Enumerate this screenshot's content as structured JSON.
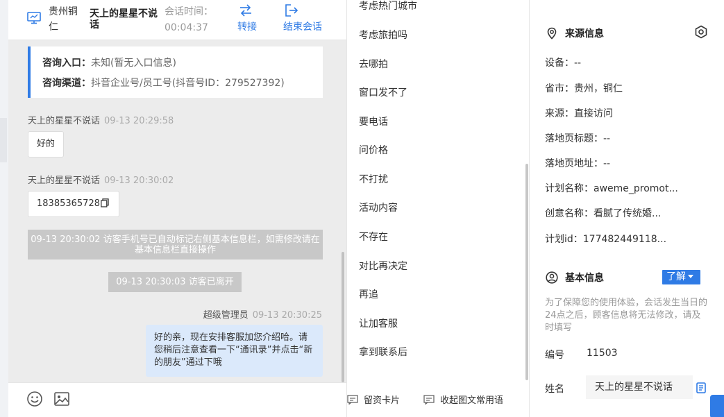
{
  "header": {
    "location": "贵州铜仁",
    "visitor_name": "天上的星星不说话",
    "session_time_label": "会话时间：",
    "session_time_value": "00:04:37",
    "transfer_label": "转接",
    "end_label": "结束会话",
    "accent_color": "#2f7be5"
  },
  "info_card": {
    "entry_key": "咨询入口：",
    "entry_value": "未知(暂无入口信息)",
    "channel_key": "咨询渠道：",
    "channel_value": "抖音企业号/员工号(抖音号ID：279527392)"
  },
  "messages": [
    {
      "sender": "天上的星星不说话",
      "time": "09-13 20:29:58",
      "text": "好的"
    },
    {
      "sender": "天上的星星不说话",
      "time": "09-13 20:30:02",
      "text": "18385365728"
    }
  ],
  "system_notices": [
    "09-13 20:30:02 访客手机号已自动标记右侧基本信息栏，如需修改请在基本信息栏直接操作",
    "09-13 20:30:03 访客已离开"
  ],
  "agent_message": {
    "sender": "超级管理员",
    "time": "09-13 20:30:25",
    "text": "好的亲，现在安排客服加您介绍哈。请您稍后注意查看一下“通讯录”并点击“新的朋友”通过下哦"
  },
  "footer_icons": [
    "emoji-icon",
    "image-icon"
  ],
  "phrases": [
    "考虑热门城市",
    "考虑旅拍吗",
    "去哪拍",
    "窗口发不了",
    "要电话",
    "问价格",
    "不打扰",
    "活动内容",
    "不存在",
    "对比再决定",
    "再追",
    "让加客服",
    "拿到联系后"
  ],
  "phrase_footer": {
    "card_label": "留资卡片",
    "fav_label": "收起图文常用语"
  },
  "source_info": {
    "title": "来源信息",
    "device": "设备：--",
    "province_city": "省市：贵州，铜仁",
    "source": "来源：直接访问",
    "landing_title": "落地页标题：--",
    "landing_url": "落地页地址：--",
    "plan_name": "计划名称：aweme_promot...",
    "creative_name": "创意名称：看腻了传统婚...",
    "plan_id": "计划id：177482449118..."
  },
  "basic_info": {
    "title": "基本信息",
    "learn_label": "了解",
    "note": "为了保障您的使用体验，会话发生当日的24点之后，顾客信息将无法修改，请及时填写",
    "id_label": "编号",
    "id_value": "11503",
    "name_label": "姓名",
    "name_value": "天上的星星不说话"
  }
}
